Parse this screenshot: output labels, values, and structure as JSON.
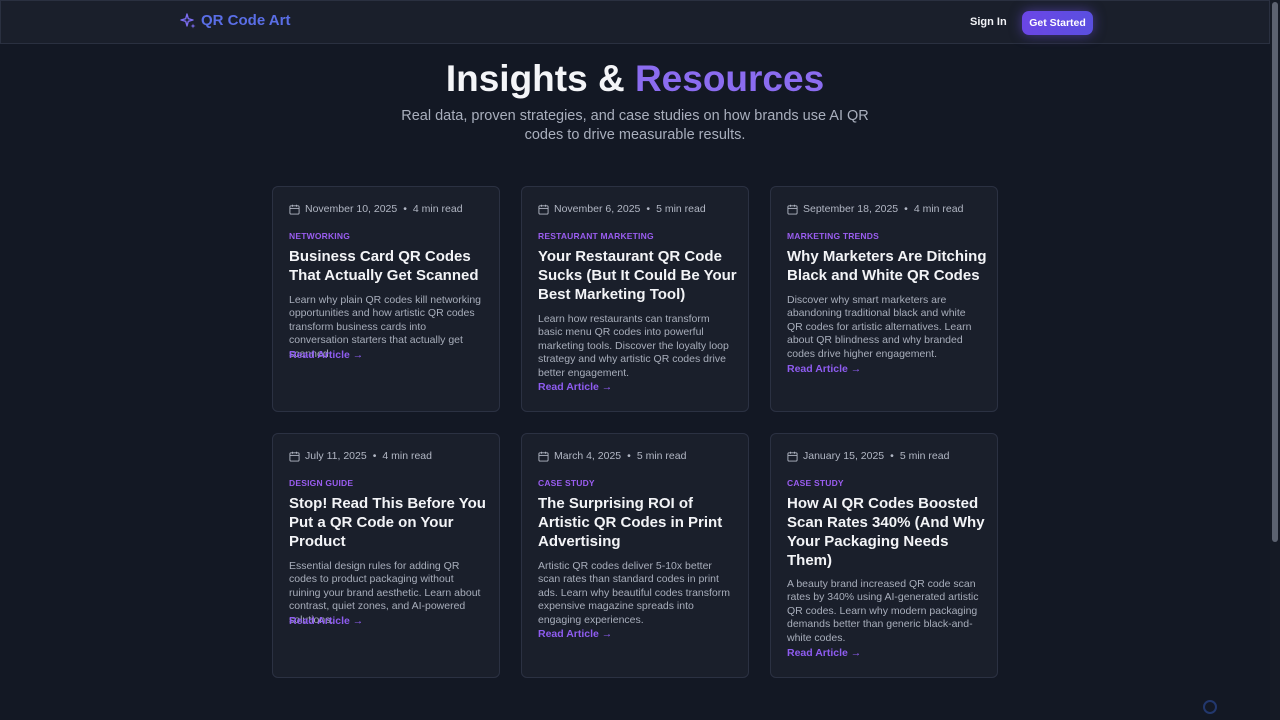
{
  "nav": {
    "brand": "QR Code Art",
    "signin": "Sign In",
    "cta": "Get Started"
  },
  "hero": {
    "title_main": "Insights & ",
    "title_accent": "Resources",
    "subtitle": "Real data, proven strategies, and case studies on how brands use AI QR codes to drive measurable results."
  },
  "articles": [
    {
      "date": "November 10, 2025",
      "read_time": "4 min read",
      "category": "NETWORKING",
      "title": "Business Card QR Codes That Actually Get Scanned",
      "description": "Learn why plain QR codes kill networking opportunities and how artistic QR codes transform business cards into conversation starters that actually get scanned.",
      "link": "Read Article →"
    },
    {
      "date": "November 6, 2025",
      "read_time": "5 min read",
      "category": "RESTAURANT MARKETING",
      "title": "Your Restaurant QR Code Sucks (But It Could Be Your Best Marketing Tool)",
      "description": "Learn how restaurants can transform basic menu QR codes into powerful marketing tools. Discover the loyalty loop strategy and why artistic QR codes drive better engagement.",
      "link": "Read Article →"
    },
    {
      "date": "September 18, 2025",
      "read_time": "4 min read",
      "category": "MARKETING TRENDS",
      "title": "Why Marketers Are Ditching Black and White QR Codes",
      "description": "Discover why smart marketers are abandoning traditional black and white QR codes for artistic alternatives. Learn about QR blindness and why branded codes drive higher engagement.",
      "link": "Read Article →"
    },
    {
      "date": "July 11, 2025",
      "read_time": "4 min read",
      "category": "DESIGN GUIDE",
      "title": "Stop! Read This Before You Put a QR Code on Your Product",
      "description": "Essential design rules for adding QR codes to product packaging without ruining your brand aesthetic. Learn about contrast, quiet zones, and AI-powered solutions.",
      "link": "Read Article →"
    },
    {
      "date": "March 4, 2025",
      "read_time": "5 min read",
      "category": "CASE STUDY",
      "title": "The Surprising ROI of Artistic QR Codes in Print Advertising",
      "description": "Artistic QR codes deliver 5-10x better scan rates than standard codes in print ads. Learn why beautiful codes transform expensive magazine spreads into engaging experiences.",
      "link": "Read Article →"
    },
    {
      "date": "January 15, 2025",
      "read_time": "5 min read",
      "category": "CASE STUDY",
      "title": "How AI QR Codes Boosted Scan Rates 340% (And Why Your Packaging Needs Them)",
      "description": "A beauty brand increased QR code scan rates by 340% using AI-generated artistic QR codes. Learn why modern packaging demands better than generic black-and-white codes.",
      "link": "Read Article →"
    }
  ],
  "meta_separator": "•",
  "colors": {
    "background": "#131824",
    "card": "#1a1f2b",
    "accent": "#8b6cf0",
    "brand": "#5a6ee6",
    "category": "#9a5df0"
  }
}
